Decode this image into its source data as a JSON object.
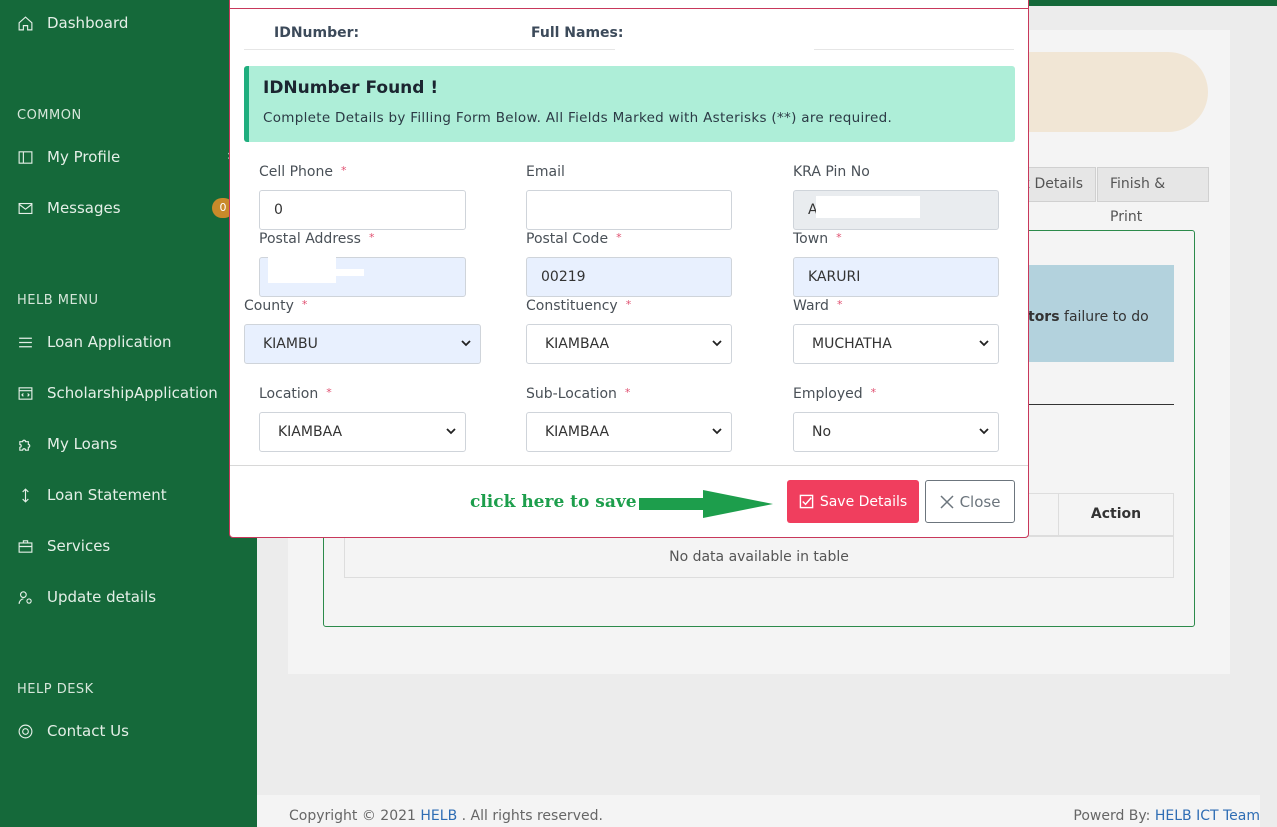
{
  "sidebar": {
    "dashboard": "Dashboard",
    "common_heading": "COMMON",
    "my_profile": "My Profile",
    "messages": "Messages",
    "messages_badge": "0",
    "helb_menu_heading": "HELB MENU",
    "loan_application": "Loan Application",
    "scholarship_application": "ScholarshipApplication",
    "my_loans": "My Loans",
    "loan_statement": "Loan Statement",
    "services": "Services",
    "update_details": "Update details",
    "help_desk_heading": "HELP DESK",
    "contact_us": "Contact Us"
  },
  "background": {
    "tab_bank_details": "k Details",
    "tab_finish_print": "Finish & Print",
    "info_text_bold": "tors",
    "info_text_rest": " failure to do",
    "table_action_header": "Action",
    "table_empty": "No data available in table"
  },
  "footer": {
    "copyright_prefix": "Copyright © 2021 ",
    "copyright_link": "HELB",
    "copyright_suffix": " . All rights reserved.",
    "powered_prefix": "Powerd By: ",
    "powered_link": "HELB ICT Team"
  },
  "modal": {
    "id_number_label": "IDNumber:",
    "full_names_label": "Full Names:",
    "alert_title": "IDNumber Found !",
    "alert_text": "Complete Details by Filling Form Below. All Fields Marked with Asterisks (**) are required.",
    "fields": {
      "cell_phone": {
        "label": "Cell Phone",
        "value": "0",
        "required": "*"
      },
      "email": {
        "label": "Email",
        "value": ""
      },
      "kra_pin": {
        "label": "KRA Pin No",
        "value": "A"
      },
      "postal_address": {
        "label": "Postal Address",
        "value": "",
        "required": "*"
      },
      "postal_code": {
        "label": "Postal Code",
        "value": "00219",
        "required": "*"
      },
      "town": {
        "label": "Town",
        "value": "KARURI",
        "required": "*"
      },
      "county": {
        "label": "County",
        "value": "KIAMBU",
        "required": "*"
      },
      "constituency": {
        "label": "Constituency",
        "value": "KIAMBAA",
        "required": "*"
      },
      "ward": {
        "label": "Ward",
        "value": "MUCHATHA",
        "required": "*"
      },
      "location": {
        "label": "Location",
        "value": "KIAMBAA",
        "required": "*"
      },
      "sub_location": {
        "label": "Sub-Location",
        "value": "KIAMBAA",
        "required": "*"
      },
      "employed": {
        "label": "Employed",
        "value": "No",
        "required": "*"
      }
    },
    "hint_text": "click here to save",
    "save_button": "Save Details",
    "close_button": "Close"
  },
  "colors": {
    "sidebar_green": "#15693a",
    "alert_bg": "#aeeed8",
    "save_red": "#f03e5e",
    "hint_green": "#1d9e4c"
  }
}
